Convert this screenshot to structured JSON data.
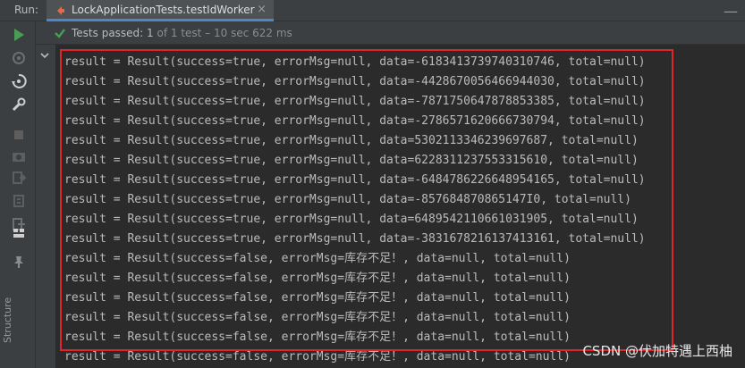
{
  "run_panel": {
    "run_label": "Run:",
    "tab_title": "LockApplicationTests.testIdWorker",
    "close_glyph": "×",
    "hide_glyph": "—"
  },
  "status": {
    "main": "Tests passed:",
    "count": "1",
    "detail": "of 1 test – 10 sec 622 ms"
  },
  "sidebar": {
    "structure_label": "Structure"
  },
  "console": {
    "lines": [
      "result = Result(success=true, errorMsg=null, data=-6183413739740310746, total=null)",
      "result = Result(success=true, errorMsg=null, data=-4428670056466944030, total=null)",
      "result = Result(success=true, errorMsg=null, data=-7871750647878853385, total=null)",
      "result = Result(success=true, errorMsg=null, data=-2786571620666730794, total=null)",
      "result = Result(success=true, errorMsg=null, data=5302113346239697687, total=null)",
      "result = Result(success=true, errorMsg=null, data=6228311237553315610, total=null)",
      "result = Result(success=true, errorMsg=null, data=-6484786226648954165, total=null)",
      "result = Result(success=true, errorMsg=null, data=-857684870865147I0, total=null)",
      "result = Result(success=true, errorMsg=null, data=6489542110661031905, total=null)",
      "result = Result(success=true, errorMsg=null, data=-3831678216137413161, total=null)",
      "result = Result(success=false, errorMsg=库存不足！, data=null, total=null)",
      "result = Result(success=false, errorMsg=库存不足！, data=null, total=null)",
      "result = Result(success=false, errorMsg=库存不足！, data=null, total=null)",
      "result = Result(success=false, errorMsg=库存不足！, data=null, total=null)",
      "result = Result(success=false, errorMsg=库存不足！, data=null, total=null)",
      "result = Result(success=false, errorMsg=库存不足！, data=null, total=null)"
    ]
  },
  "watermark": "CSDN @伏加特遇上西柚",
  "colors": {
    "panel": "#3c3f41",
    "console_bg": "#2b2b2b",
    "pass_green": "#499c54",
    "highlight_red": "#e0262b"
  }
}
